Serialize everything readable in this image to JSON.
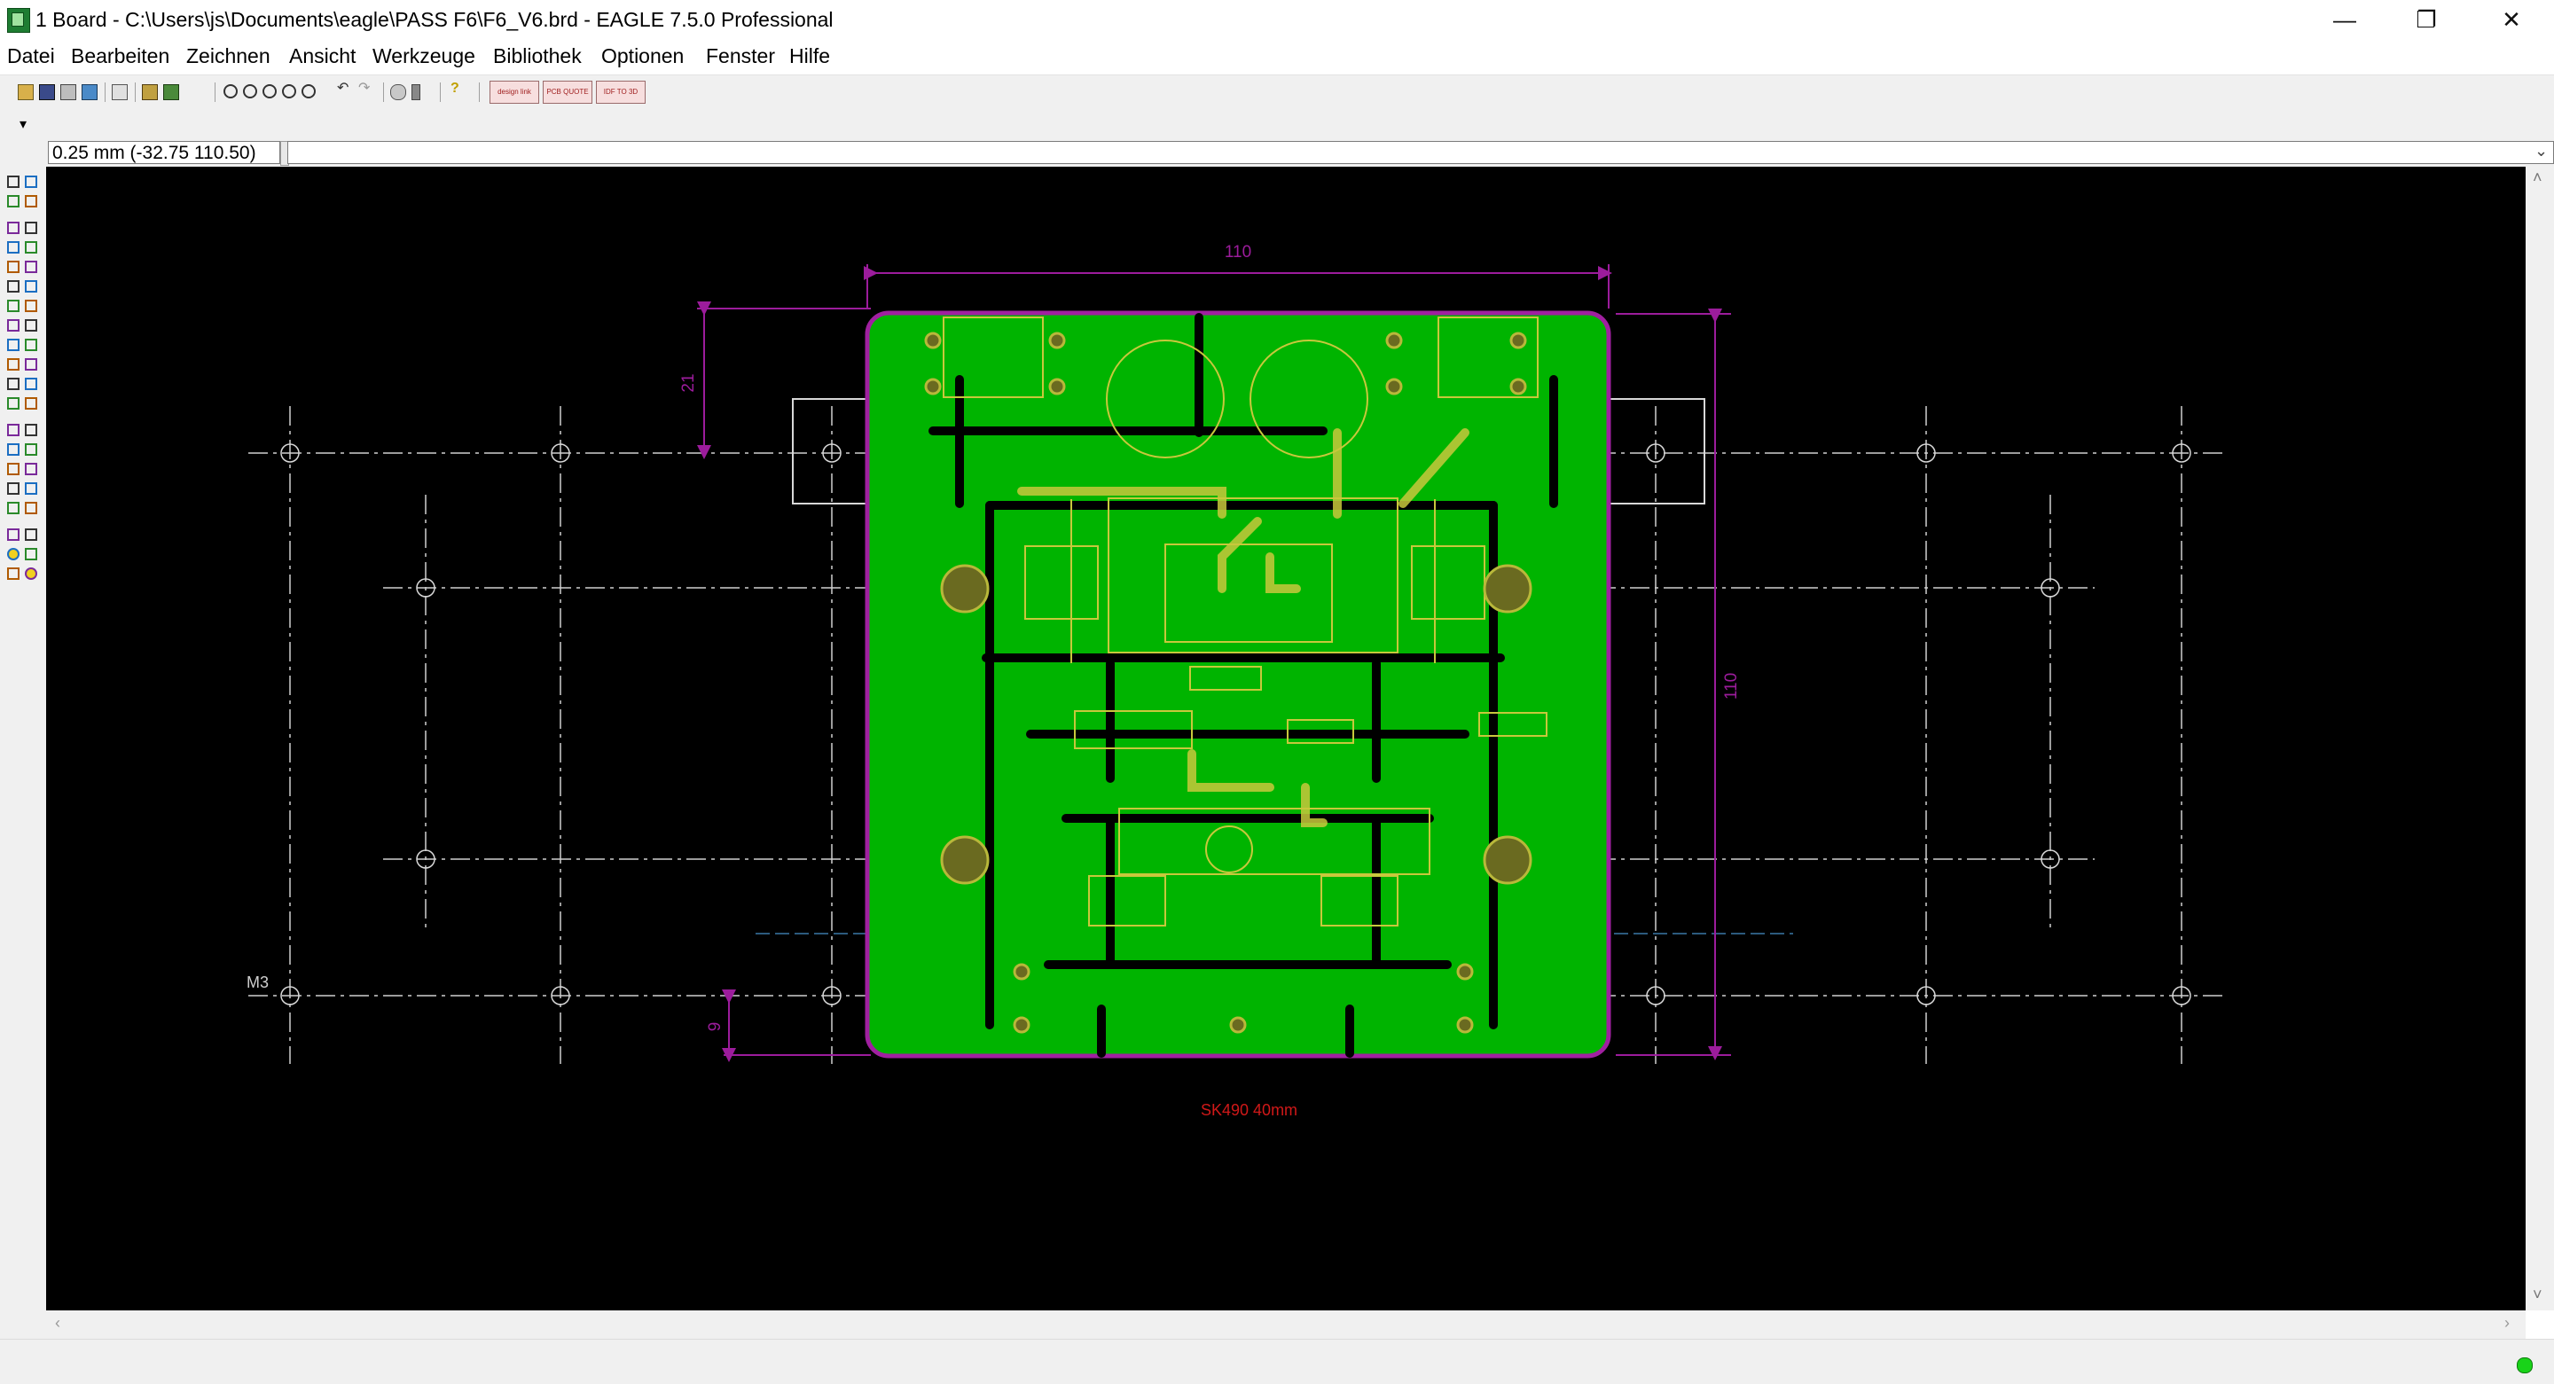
{
  "window": {
    "title": "1 Board - C:\\Users\\js\\Documents\\eagle\\PASS F6\\F6_V6.brd - EAGLE 7.5.0 Professional",
    "minimize_label": "—",
    "maximize_label": "❐",
    "close_label": "✕"
  },
  "menu": [
    {
      "label": "Datei"
    },
    {
      "label": "Bearbeiten"
    },
    {
      "label": "Zeichnen"
    },
    {
      "label": "Ansicht"
    },
    {
      "label": "Werkzeuge"
    },
    {
      "label": "Bibliothek"
    },
    {
      "label": "Optionen"
    },
    {
      "label": "Fenster"
    },
    {
      "label": "Hilfe"
    }
  ],
  "toolbar": {
    "icons": [
      "open-icon",
      "save-icon",
      "print-icon",
      "cam-icon",
      "board-schematic-icon",
      "script-icon",
      "run-ulp-icon",
      "zoom-fit-icon",
      "zoom-in-icon",
      "zoom-out-icon",
      "zoom-redraw-icon",
      "zoom-select-icon",
      "undo-icon",
      "redo-icon",
      "stop-icon",
      "go-icon",
      "help-icon"
    ],
    "designlink_label": "design link",
    "pcb_quote_label": "PCB QUOTE",
    "idf_label": "IDF TO 3D",
    "layer_dropdown_icon": "▾"
  },
  "command": {
    "coordinate": "0.25 mm (-32.75 110.50)",
    "input_value": "",
    "input_placeholder": ""
  },
  "board": {
    "dim_width": "110",
    "dim_height": "110",
    "dim_left_top": "21",
    "dim_left_bottom": "9",
    "label_m3": "M3",
    "heatsink_label": "SK490 40mm",
    "colors": {
      "background": "#000000",
      "copper": "#00b400",
      "outline": "#a020a0",
      "silkscreen": "#c8c83c",
      "dimension": "#9c1c9c",
      "heatsink_label": "#d01818",
      "grid": "#d0d0d0"
    }
  },
  "scrollbars": {
    "up_arrow": "˄",
    "down_arrow": "˅",
    "left_arrow": "‹",
    "right_arrow": "›"
  }
}
